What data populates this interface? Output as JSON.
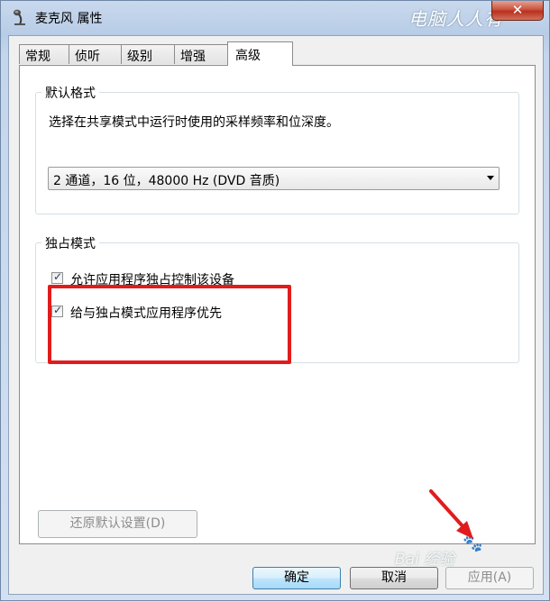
{
  "window": {
    "title": "麦克风 属性",
    "close_glyph": "✕",
    "app_icon": "microphone-icon"
  },
  "watermark": {
    "top_right": "电脑人人有",
    "bottom_logo": "Bai 经验",
    "paw_glyph": "🐾"
  },
  "tabs": [
    {
      "label": "常规",
      "active": false
    },
    {
      "label": "侦听",
      "active": false
    },
    {
      "label": "级别",
      "active": false
    },
    {
      "label": "增强",
      "active": false
    },
    {
      "label": "高级",
      "active": true
    }
  ],
  "default_format": {
    "group_title": "默认格式",
    "description": "选择在共享模式中运行时使用的采样频率和位深度。",
    "selected_value": "2 通道，16 位，48000 Hz (DVD 音质)"
  },
  "exclusive_mode": {
    "group_title": "独占模式",
    "options": [
      {
        "label": "允许应用程序独占控制该设备",
        "checked": true
      },
      {
        "label": "给与独占模式应用程序优先",
        "checked": true
      }
    ],
    "check_glyph": "✓"
  },
  "buttons": {
    "restore_defaults": "还原默认设置(D)",
    "ok": "确定",
    "cancel": "取消",
    "apply": "应用(A)"
  },
  "annotation_colors": {
    "highlight": "#e01c1c",
    "arrow": "#e01c1c"
  }
}
